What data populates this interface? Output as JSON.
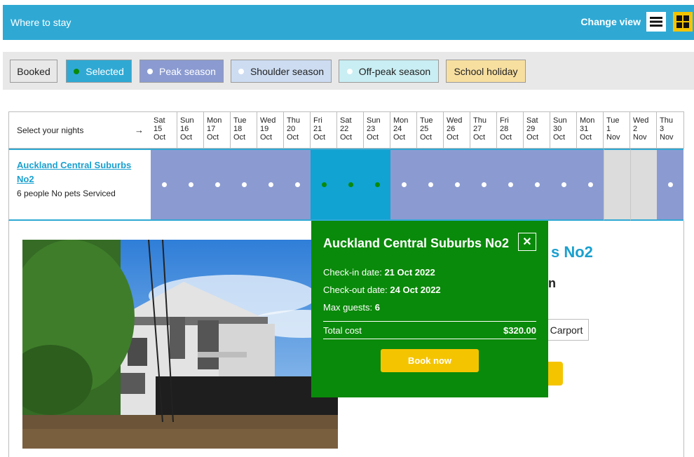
{
  "header": {
    "title": "Where to stay",
    "change_view_label": "Change view",
    "list_icon": "list-icon",
    "grid_icon": "grid-icon"
  },
  "legend": [
    {
      "label": "Booked",
      "bg": "#e8e8e8",
      "color": "#222",
      "dot": null
    },
    {
      "label": "Selected",
      "bg": "#2fa9d4",
      "color": "#ffffff",
      "dot": "#0a8a0a"
    },
    {
      "label": "Peak season",
      "bg": "#8b9bd1",
      "color": "#ffffff",
      "dot": "#ffffff"
    },
    {
      "label": "Shoulder season",
      "bg": "#cddcf1",
      "color": "#222",
      "dot": "#ffffff"
    },
    {
      "label": "Off-peak season",
      "bg": "#c9eef3",
      "color": "#222",
      "dot": "#ffffff"
    },
    {
      "label": "School holiday",
      "bg": "#f7dfa0",
      "color": "#222",
      "dot": null
    }
  ],
  "calendar": {
    "select_nights_label": "Select your nights",
    "arrow": "→",
    "days": [
      {
        "dow": "Sat",
        "day": "15",
        "mon": "Oct",
        "state": "peak"
      },
      {
        "dow": "Sun",
        "day": "16",
        "mon": "Oct",
        "state": "peak"
      },
      {
        "dow": "Mon",
        "day": "17",
        "mon": "Oct",
        "state": "peak"
      },
      {
        "dow": "Tue",
        "day": "18",
        "mon": "Oct",
        "state": "peak"
      },
      {
        "dow": "Wed",
        "day": "19",
        "mon": "Oct",
        "state": "peak"
      },
      {
        "dow": "Thu",
        "day": "20",
        "mon": "Oct",
        "state": "peak"
      },
      {
        "dow": "Fri",
        "day": "21",
        "mon": "Oct",
        "state": "selected"
      },
      {
        "dow": "Sat",
        "day": "22",
        "mon": "Oct",
        "state": "selected"
      },
      {
        "dow": "Sun",
        "day": "23",
        "mon": "Oct",
        "state": "selected"
      },
      {
        "dow": "Mon",
        "day": "24",
        "mon": "Oct",
        "state": "peak"
      },
      {
        "dow": "Tue",
        "day": "25",
        "mon": "Oct",
        "state": "peak"
      },
      {
        "dow": "Wed",
        "day": "26",
        "mon": "Oct",
        "state": "peak"
      },
      {
        "dow": "Thu",
        "day": "27",
        "mon": "Oct",
        "state": "peak"
      },
      {
        "dow": "Fri",
        "day": "28",
        "mon": "Oct",
        "state": "peak"
      },
      {
        "dow": "Sat",
        "day": "29",
        "mon": "Oct",
        "state": "peak"
      },
      {
        "dow": "Sun",
        "day": "30",
        "mon": "Oct",
        "state": "peak"
      },
      {
        "dow": "Mon",
        "day": "31",
        "mon": "Oct",
        "state": "peak"
      },
      {
        "dow": "Tue",
        "day": "1",
        "mon": "Nov",
        "state": "booked"
      },
      {
        "dow": "Wed",
        "day": "2",
        "mon": "Nov",
        "state": "booked"
      },
      {
        "dow": "Thu",
        "day": "3",
        "mon": "Nov",
        "state": "peak"
      }
    ],
    "colors": {
      "peak": "#8b9bd1",
      "selected": "#11a3d2",
      "booked": "#dcdcdc",
      "dot_peak": "#ffffff",
      "dot_selected": "#0a8a0a"
    }
  },
  "property": {
    "name": "Auckland Central Suburbs No2",
    "details": "6 people No pets Serviced",
    "bg_title_fragment": "s No2",
    "bg_sub_fragment": "n",
    "bg_chip": "Carport"
  },
  "popup": {
    "title": "Auckland Central Suburbs No2",
    "close": "✕",
    "checkin_label": "Check-in date: ",
    "checkin_value": "21 Oct 2022",
    "checkout_label": "Check-out date: ",
    "checkout_value": "24 Oct 2022",
    "guests_label": "Max guests: ",
    "guests_value": "6",
    "total_label": "Total cost",
    "total_value": "$320.00",
    "book_label": "Book now"
  }
}
